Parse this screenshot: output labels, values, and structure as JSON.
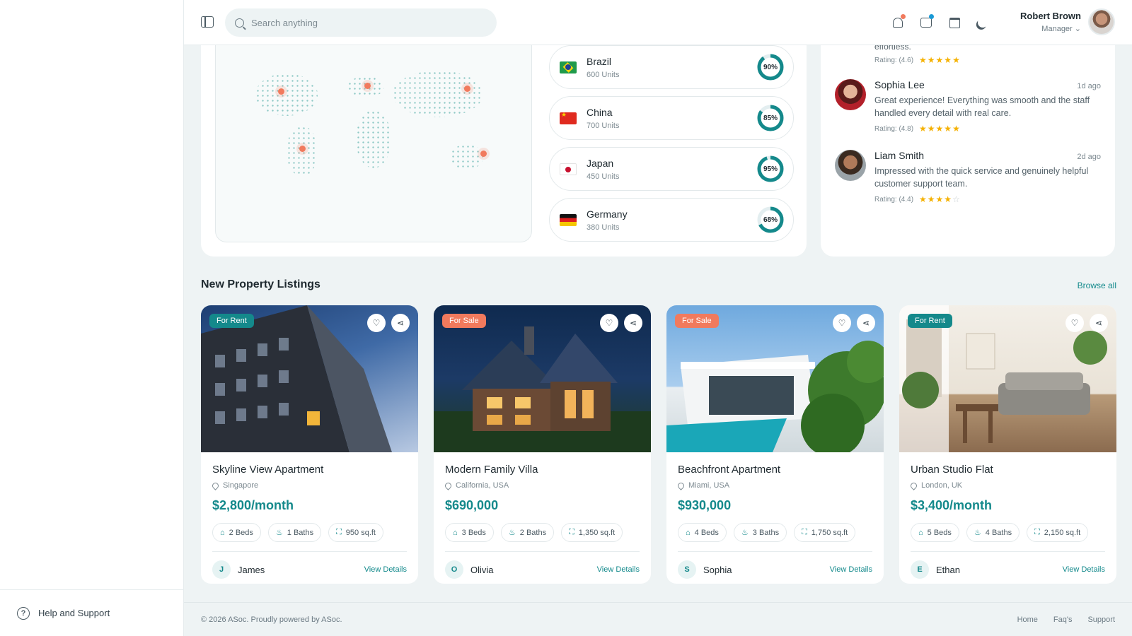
{
  "header": {
    "search_placeholder": "Search anything",
    "user_name": "Robert Brown",
    "user_role": "Manager",
    "notification_dot_color": "#f17a5d",
    "message_dot_color": "#1a9ad6"
  },
  "sidebar": {
    "help_label": "Help and Support"
  },
  "countries": [
    {
      "name": "Brazil",
      "units": "600 Units",
      "percent": 90,
      "percent_label": "90%"
    },
    {
      "name": "China",
      "units": "700 Units",
      "percent": 85,
      "percent_label": "85%"
    },
    {
      "name": "Japan",
      "units": "450 Units",
      "percent": 95,
      "percent_label": "95%"
    },
    {
      "name": "Germany",
      "units": "380 Units",
      "percent": 68,
      "percent_label": "68%"
    }
  ],
  "reviews": {
    "partial_text": "effortless.",
    "partial_rating": "Rating: (4.6)",
    "items": [
      {
        "name": "Sophia Lee",
        "ago": "1d ago",
        "text": "Great experience! Everything was smooth and the staff handled every detail with real care.",
        "rating": "Rating: (4.8)",
        "stars": 5
      },
      {
        "name": "Liam Smith",
        "ago": "2d ago",
        "text": "Impressed with the quick service and genuinely helpful customer support team.",
        "rating": "Rating: (4.4)",
        "stars": 4
      }
    ]
  },
  "listings": {
    "title": "New Property Listings",
    "browse_label": "Browse all",
    "cards": [
      {
        "tag": "For Rent",
        "title": "Skyline View Apartment",
        "location": "Singapore",
        "price": "$2,800/month",
        "beds": "2 Beds",
        "baths": "1 Baths",
        "area": "950 sq.ft",
        "agent_initial": "J",
        "agent": "James",
        "action": "View Details"
      },
      {
        "tag": "For Sale",
        "title": "Modern Family Villa",
        "location": "California, USA",
        "price": "$690,000",
        "beds": "3 Beds",
        "baths": "2 Baths",
        "area": "1,350 sq.ft",
        "agent_initial": "O",
        "agent": "Olivia",
        "action": "View Details"
      },
      {
        "tag": "For Sale",
        "title": "Beachfront Apartment",
        "location": "Miami, USA",
        "price": "$930,000",
        "beds": "4 Beds",
        "baths": "3 Baths",
        "area": "1,750 sq.ft",
        "agent_initial": "S",
        "agent": "Sophia",
        "action": "View Details"
      },
      {
        "tag": "For Rent",
        "title": "Urban Studio Flat",
        "location": "London, UK",
        "price": "$3,400/month",
        "beds": "5 Beds",
        "baths": "4 Baths",
        "area": "2,150 sq.ft",
        "agent_initial": "E",
        "agent": "Ethan",
        "action": "View Details"
      }
    ]
  },
  "footer": {
    "copyright": "© 2026 ASoc. Proudly powered by ASoc.",
    "links": [
      "Home",
      "Faq's",
      "Support"
    ]
  },
  "colors": {
    "accent": "#14898b",
    "sale": "#f17a5d",
    "star": "#f5b100"
  }
}
